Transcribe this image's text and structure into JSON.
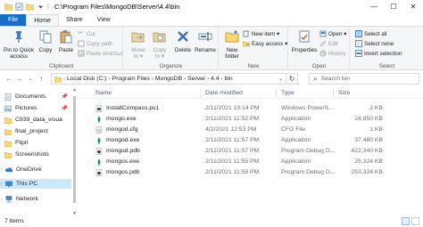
{
  "titlebar": {
    "title": "C:\\Program Files\\MongoDB\\Server\\4.4\\bin",
    "minimize": "—",
    "maximize": "☐",
    "close": "✕"
  },
  "tabs": {
    "file": "File",
    "home": "Home",
    "share": "Share",
    "view": "View"
  },
  "ribbon": {
    "clipboard": {
      "label": "Clipboard",
      "pin_line1": "Pin to Quick",
      "pin_line2": "access",
      "copy": "Copy",
      "paste": "Paste",
      "cut": "Cut",
      "copy_path": "Copy path",
      "paste_shortcut": "Paste shortcut"
    },
    "organize": {
      "label": "Organize",
      "move_line1": "Move",
      "move_line2": "to ▾",
      "copy_line1": "Copy",
      "copy_line2": "to ▾",
      "delete": "Delete",
      "rename": "Rename"
    },
    "new": {
      "label": "New",
      "new_folder_line1": "New",
      "new_folder_line2": "folder",
      "new_item": "New item ▾",
      "easy_access": "Easy access ▾"
    },
    "open": {
      "label": "Open",
      "properties": "Properties",
      "open": "Open ▾",
      "edit": "Edit",
      "history": "History"
    },
    "select": {
      "label": "Select",
      "select_all": "Select all",
      "select_none": "Select none",
      "invert": "Invert selection"
    }
  },
  "address": {
    "crumbs": [
      "Local Disk (C:)",
      "Program Files",
      "MongoDB",
      "Server",
      "4.4",
      "bin"
    ],
    "search_placeholder": "Search bin"
  },
  "navpane": {
    "items": [
      {
        "label": "Documents",
        "icon": "documents-icon",
        "pinned": true
      },
      {
        "label": "Pictures",
        "icon": "pictures-icon",
        "pinned": true
      },
      {
        "label": "C939_data_visua",
        "icon": "folder-icon",
        "pinned": false
      },
      {
        "label": "final_project",
        "icon": "folder-icon",
        "pinned": false
      },
      {
        "label": "Flipit",
        "icon": "folder-icon",
        "pinned": false
      },
      {
        "label": "Screenshots",
        "icon": "folder-icon",
        "pinned": false
      },
      {
        "label": "OneDrive",
        "icon": "onedrive-icon",
        "pinned": false
      },
      {
        "label": "This PC",
        "icon": "this-pc-icon",
        "pinned": false
      },
      {
        "label": "Network",
        "icon": "network-icon",
        "pinned": false
      }
    ]
  },
  "filelist": {
    "headers": {
      "name": "Name",
      "date": "Date modified",
      "type": "Type",
      "size": "Size"
    },
    "rows": [
      {
        "name": "InstallCompass.ps1",
        "date": "2/11/2021 10:14 PM",
        "type": "Windows PowerS...",
        "size": "2 KB",
        "icon": "powershell-file-icon"
      },
      {
        "name": "mongo.exe",
        "date": "2/11/2021 11:52 PM",
        "type": "Application",
        "size": "24,850 KB",
        "icon": "mongo-exe-icon"
      },
      {
        "name": "mongod.cfg",
        "date": "4/2/2021 12:53 PM",
        "type": "CFG File",
        "size": "1 KB",
        "icon": "cfg-file-icon"
      },
      {
        "name": "mongod.exe",
        "date": "2/11/2021 11:57 PM",
        "type": "Application",
        "size": "37,480 KB",
        "icon": "mongo-exe-icon"
      },
      {
        "name": "mongod.pdb",
        "date": "2/11/2021 11:57 PM",
        "type": "Program Debug D...",
        "size": "422,340 KB",
        "icon": "pdb-file-icon"
      },
      {
        "name": "mongos.exe",
        "date": "2/11/2021 11:55 PM",
        "type": "Application",
        "size": "25,324 KB",
        "icon": "mongo-exe-icon"
      },
      {
        "name": "mongos.pdb",
        "date": "2/11/2021 11:55 PM",
        "type": "Program Debug D...",
        "size": "253,324 KB",
        "icon": "pdb-file-icon"
      }
    ]
  },
  "status": {
    "count": "7 items"
  },
  "colors": {
    "accent": "#1a6ec7",
    "selection": "#cce8ff",
    "folder": "#f8d775",
    "header_text": "#4c607a"
  }
}
